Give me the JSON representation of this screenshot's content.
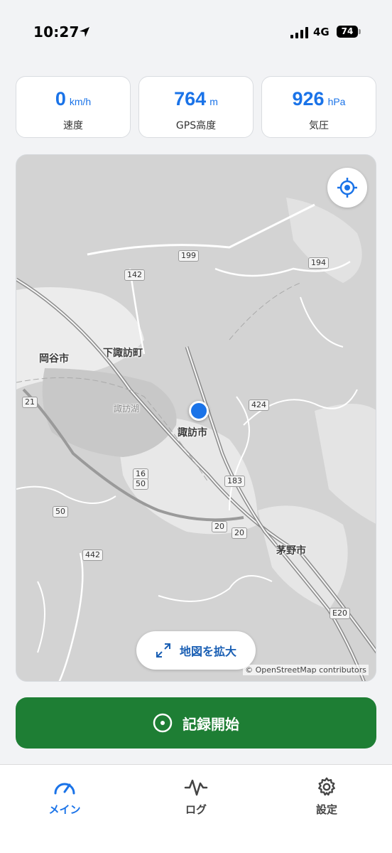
{
  "status_bar": {
    "time": "10:27",
    "network": "4G",
    "battery": "74"
  },
  "stats": [
    {
      "value": "0",
      "unit": "km/h",
      "label": "速度"
    },
    {
      "value": "764",
      "unit": "m",
      "label": "GPS高度"
    },
    {
      "value": "926",
      "unit": "hPa",
      "label": "気圧"
    }
  ],
  "map": {
    "places": {
      "okaya": "岡谷市",
      "shimosuwa": "下諏訪町",
      "suwa": "諏訪市",
      "chino": "茅野市",
      "suwako": "諏訪湖"
    },
    "roads": {
      "r199": "199",
      "r142": "142",
      "r194": "194",
      "r424": "424",
      "r183": "183",
      "r16": "16",
      "r50a": "50",
      "r50b": "50",
      "r442": "442",
      "r20a": "20",
      "r20b": "20",
      "r21": "21",
      "e20": "E20"
    },
    "expand_label": "地図を拡大",
    "attribution": "© OpenStreetMap contributors"
  },
  "record_label": "記録開始",
  "tabs": [
    {
      "label": "メイン",
      "icon": "speedometer-icon",
      "active": true
    },
    {
      "label": "ログ",
      "icon": "pulse-icon",
      "active": false
    },
    {
      "label": "設定",
      "icon": "gear-icon",
      "active": false
    }
  ],
  "colors": {
    "accent": "#1a73e8",
    "record": "#1e7e34"
  }
}
